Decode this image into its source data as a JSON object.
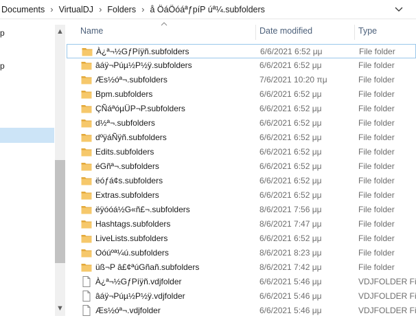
{
  "breadcrumb": {
    "items": [
      "Documents",
      "VirtualDJ",
      "Folders",
      "å ÖáÖóáªƒpíP úª¼.subfolders"
    ],
    "separator": "›"
  },
  "nav": {
    "fragments": [
      "p",
      "p"
    ]
  },
  "columns": {
    "name": "Name",
    "date": "Date modified",
    "type": "Type"
  },
  "files": [
    {
      "name": "À¿ª¬½GƒPíÿñ.subfolders",
      "date": "6/6/2021 6:52 μμ",
      "type": "File folder",
      "kind": "folder"
    },
    {
      "name": "âáÿ¬Púµ½P½ÿ.subfolders",
      "date": "6/6/2021 6:52 μμ",
      "type": "File folder",
      "kind": "folder"
    },
    {
      "name": "Æs½óª¬.subfolders",
      "date": "7/6/2021 10:20 πμ",
      "type": "File folder",
      "kind": "folder"
    },
    {
      "name": "Bpm.subfolders",
      "date": "6/6/2021 6:52 μμ",
      "type": "File folder",
      "kind": "folder"
    },
    {
      "name": "ÇÑáªóµÜP¬P.subfolders",
      "date": "6/6/2021 6:52 μμ",
      "type": "File folder",
      "kind": "folder"
    },
    {
      "name": "d½ª¬.subfolders",
      "date": "6/6/2021 6:52 μμ",
      "type": "File folder",
      "kind": "folder"
    },
    {
      "name": "dºÿáÑÿñ.subfolders",
      "date": "6/6/2021 6:52 μμ",
      "type": "File folder",
      "kind": "folder"
    },
    {
      "name": "Edits.subfolders",
      "date": "6/6/2021 6:52 μμ",
      "type": "File folder",
      "kind": "folder"
    },
    {
      "name": "éGñª¬.subfolders",
      "date": "6/6/2021 6:52 μμ",
      "type": "File folder",
      "kind": "folder"
    },
    {
      "name": "ëóƒá¢s.subfolders",
      "date": "6/6/2021 6:52 μμ",
      "type": "File folder",
      "kind": "folder"
    },
    {
      "name": "Extras.subfolders",
      "date": "6/6/2021 6:52 μμ",
      "type": "File folder",
      "kind": "folder"
    },
    {
      "name": "ëÿóóá½G«ñ£¬.subfolders",
      "date": "8/6/2021 7:56 μμ",
      "type": "File folder",
      "kind": "folder"
    },
    {
      "name": "Hashtags.subfolders",
      "date": "8/6/2021 7:47 μμ",
      "type": "File folder",
      "kind": "folder"
    },
    {
      "name": "LiveLists.subfolders",
      "date": "6/6/2021 6:52 μμ",
      "type": "File folder",
      "kind": "folder"
    },
    {
      "name": "Oóúºª¼ú.subfolders",
      "date": "8/6/2021 8:23 μμ",
      "type": "File folder",
      "kind": "folder"
    },
    {
      "name": "üß¬P â£¢ªúGñañ.subfolders",
      "date": "8/6/2021 7:42 μμ",
      "type": "File folder",
      "kind": "folder"
    },
    {
      "name": "À¿ª¬½GƒPíÿñ.vdjfolder",
      "date": "6/6/2021 5:46 μμ",
      "type": "VDJFOLDER File",
      "kind": "file"
    },
    {
      "name": "âáÿ¬Púµ½P½ÿ.vdjfolder",
      "date": "6/6/2021 5:46 μμ",
      "type": "VDJFOLDER File",
      "kind": "file"
    },
    {
      "name": "Æs½óª¬.vdjfolder",
      "date": "6/6/2021 5:46 μμ",
      "type": "VDJFOLDER File",
      "kind": "file"
    }
  ],
  "colors": {
    "folder": "#f6c86b",
    "folder_dark": "#e3a93b",
    "selection": "#cce4f7",
    "header_text": "#4c607a"
  }
}
